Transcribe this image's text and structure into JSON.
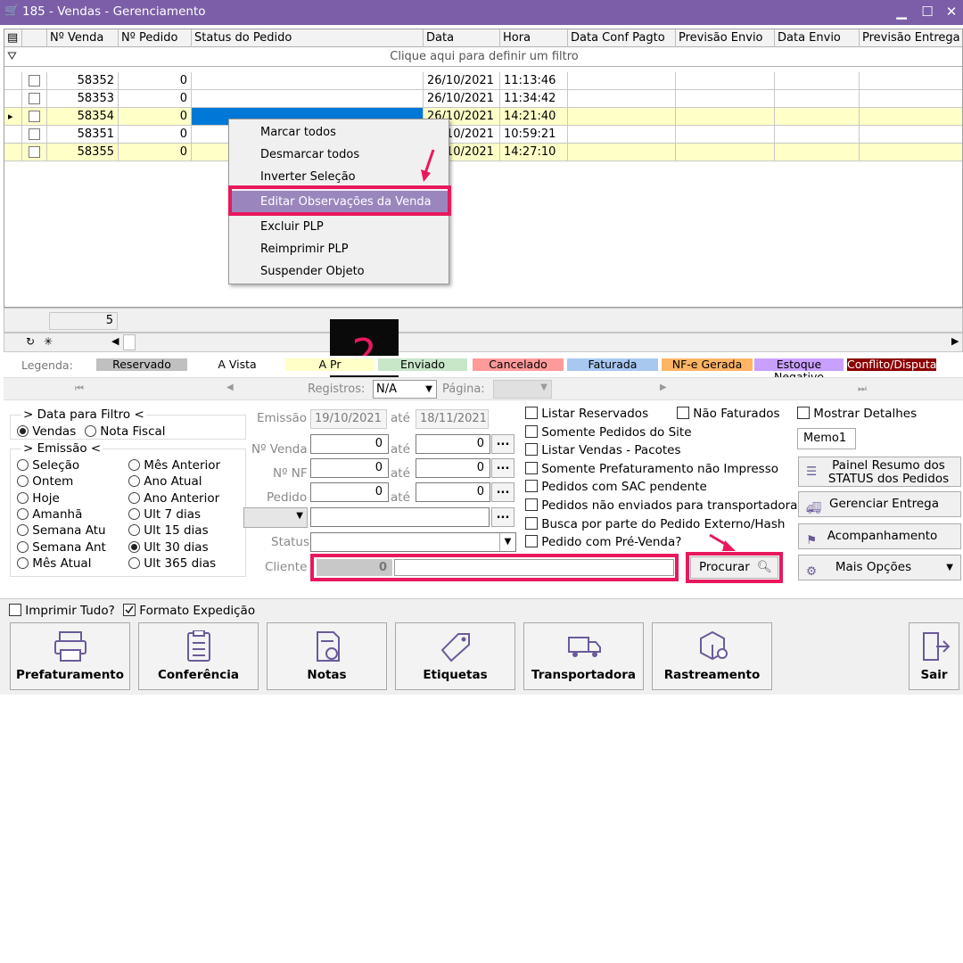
{
  "window": {
    "title": "185 - Vendas - Gerenciamento"
  },
  "grid": {
    "headers": [
      "Nº Venda",
      "Nº Pedido",
      "Status do Pedido",
      "Data",
      "Hora",
      "Data Conf Pagto",
      "Previsão Envio",
      "Data Envio",
      "Previsão Entrega"
    ],
    "filter_hint": "Clique aqui para definir um filtro",
    "rows": [
      {
        "venda": "58352",
        "pedido": "0",
        "data": "26/10/2021",
        "hora": "11:13:46"
      },
      {
        "venda": "58353",
        "pedido": "0",
        "data": "26/10/2021",
        "hora": "11:34:42"
      },
      {
        "venda": "58354",
        "pedido": "0",
        "data": "26/10/2021",
        "hora": "14:21:40"
      },
      {
        "venda": "58351",
        "pedido": "0",
        "data": "26/10/2021",
        "hora": "10:59:21"
      },
      {
        "venda": "58355",
        "pedido": "0",
        "data": "26/10/2021",
        "hora": "14:27:10"
      }
    ],
    "footer_count": "5"
  },
  "context_menu": {
    "items": [
      "Marcar todos",
      "Desmarcar todos",
      "Inverter Seleção",
      "Editar Observações da Venda",
      "Excluir PLP",
      "Reimprimir PLP",
      "Suspender Objeto"
    ]
  },
  "annotation": {
    "step": "2"
  },
  "legend": {
    "title": "Legenda:",
    "items": [
      {
        "label": "Reservado",
        "color": "#c0c0c0"
      },
      {
        "label": "A Vista",
        "color": "#ffffff"
      },
      {
        "label": "A Pr",
        "color": "#ffffc8"
      },
      {
        "label": "Enviado",
        "color": "#c8e6c8"
      },
      {
        "label": "Cancelado",
        "color": "#ff9a9a"
      },
      {
        "label": "Faturada",
        "color": "#a8c8f0"
      },
      {
        "label": "NF-e Gerada",
        "color": "#ffb464"
      },
      {
        "label": "Estoque Negativo",
        "color": "#c8a0ff"
      },
      {
        "label": "Conflito/Disputa",
        "color": "#8b0000"
      }
    ]
  },
  "nav": {
    "registros_label": "Registros:",
    "registros_value": "N/A",
    "pagina_label": "Página:"
  },
  "filters": {
    "data_para_filtro": "> Data para Filtro <",
    "vendas": "Vendas",
    "nota_fiscal": "Nota Fiscal",
    "emissao_group": "> Emissão <",
    "period_left": [
      "Seleção",
      "Ontem",
      "Hoje",
      "Amanhã",
      "Semana Atu",
      "Semana Ant",
      "Mês Atual"
    ],
    "period_right": [
      "Mês Anterior",
      "Ano Atual",
      "Ano Anterior",
      "Ult 7 dias",
      "Ult 15 dias",
      "Ult 30 dias",
      "Ult 365 dias"
    ],
    "emissao_label": "Emissão",
    "date_from": "19/10/2021",
    "date_to": "18/11/2021",
    "ate": "até",
    "num_venda_label": "Nº Venda",
    "num_nf_label": "Nº NF",
    "pedido_label": "Pedido",
    "status_label": "Status",
    "cliente_label": "Cliente",
    "zero": "0",
    "dots": "...",
    "procurar": "Procurar"
  },
  "checks": [
    "Listar Reservados",
    "Somente Pedidos do Site",
    "Listar Vendas - Pacotes",
    "Somente Prefaturamento não Impresso",
    "Pedidos com SAC pendente",
    "Pedidos não enviados para transportadora",
    "Busca por parte do Pedido Externo/Hash",
    "Pedido com Pré-Venda?"
  ],
  "nao_faturados": "Não Faturados",
  "mostrar_detalhes": "Mostrar Detalhes",
  "memo": "Memo1",
  "side_buttons": {
    "painel_line1": "Painel Resumo dos",
    "painel_line2": "STATUS dos Pedidos",
    "gerenciar": "Gerenciar Entrega",
    "acompanhamento": "Acompanhamento",
    "mais_opcoes": "Mais Opções"
  },
  "bottom": {
    "imprimir_tudo": "Imprimir Tudo?",
    "formato_expedicao": "Formato Expedição",
    "buttons": [
      "Prefaturamento",
      "Conferência",
      "Notas",
      "Etiquetas",
      "Transportadora",
      "Rastreamento"
    ],
    "sair": "Sair"
  },
  "colors": {
    "titlebar": "#7b5ea7",
    "selected_row": "#ffffc8",
    "selected_cell": "#0078d7",
    "highlight_menu": "#9a86bd",
    "annotation": "#e8185c"
  }
}
